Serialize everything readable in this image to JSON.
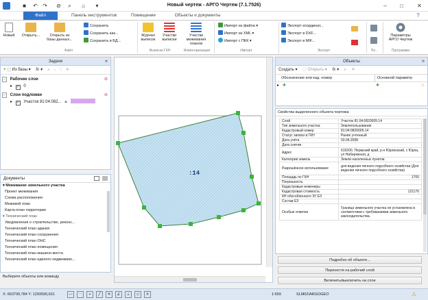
{
  "window": {
    "title": "Новый чертеж - АРГО Чертеж (7.1.7526)"
  },
  "tabs": [
    "Файл",
    "Панель инструментов",
    "Помещение",
    "Объекты и документы"
  ],
  "ribbon": {
    "big_buttons": [
      "Новый",
      "Открыть...",
      "Открыть из базы данных...",
      "Журнал выписок",
      "Участки выписки",
      "Участки межевания планов",
      "Параметры АРГО Чертеж"
    ],
    "save_buttons": [
      "Сохранить",
      "Сохранить как...",
      "Сохранить в БД..."
    ],
    "import_buttons": [
      "Импорт из файла",
      "Импорт из XML",
      "Импорт с ПКК"
    ],
    "export_buttons": [
      "Экспорт координат...",
      "Экспорт в DXF...",
      "Экспорт в MIF..."
    ],
    "groups": [
      "Файл",
      "Выписки ГКН",
      "Инвентаризация",
      "Импорт",
      "Экспорт",
      "Пе...",
      "Программа"
    ]
  },
  "tasks_panel": {
    "title": "Задачи",
    "toolbar_label": "Из базы",
    "working_section": "Рабочие слои",
    "working_layer": "0",
    "underlay_section": "Слои подложки",
    "underlay_layer": "Участок 81:04:082..."
  },
  "documents_panel": {
    "title": "Документы",
    "section_1": "Межевание земельного участка",
    "items_1": [
      "Проект межевания",
      "Схема расположения",
      "Межевой план",
      "Карта-план территории"
    ],
    "section_2": "Технический план",
    "items_2": [
      "Уведомления о строительстве, реконс...",
      "Технический план здания",
      "Технический план сооружения",
      "Технический план ОНС",
      "Технический план помещения",
      "Технический план машино-места",
      "Технический план единого недвижимо..."
    ]
  },
  "canvas": {
    "parcel_label": ":14"
  },
  "objects_panel": {
    "title": "Объекты",
    "create_label": "Создать",
    "open_label": "Открыть",
    "col_designation": "Обозначение или кад. номер",
    "col_main_param": "Основной параметр"
  },
  "properties": {
    "title": "Свойства выделенного объекта чертежа",
    "rows": [
      [
        "Слой",
        "Участок 81:04:0820005:14"
      ],
      [
        "Тип земельного участка",
        "Землепользование"
      ],
      [
        "Кадастровый номер",
        "81:04:0820005:14"
      ],
      [
        "Статус записи в ГКН",
        "Ранее учтенный"
      ],
      [
        "Дата учёта",
        "03.04.2008"
      ],
      [
        "Дата снятия",
        ""
      ],
      [
        "Адрес",
        "619200, Пермский край, р-н Юрлинский, с Юрла, ул Набережная, д"
      ],
      [
        "Категория земель",
        "Земли населенных пунктов"
      ],
      [
        "Разрешённое использование",
        "для ведения личного подсобного хозяйства (Для ведения личного подсобного хозяйства)"
      ],
      [
        "Площадь по ГКН",
        "1700"
      ],
      [
        "Погрешность",
        ""
      ],
      [
        "Кадастровые инженеры",
        ""
      ],
      [
        "Кадастровая стоимость",
        "121176"
      ],
      [
        "КН обособленного ЗУ ЕЗ",
        ""
      ],
      [
        "Состав ЕЗ",
        ""
      ],
      [
        "Особые отметки",
        "Граница земельного участка не установлена в соответствии с требованиями земельного законодательства."
      ]
    ]
  },
  "action_buttons": [
    "Подробно об объекте...",
    "Перенести на рабочий слой",
    "Включить/выключить на слое"
  ],
  "status": {
    "hint": "Выберите объекты или команду",
    "coords": "X: 663799,784 Y: 1293590,631",
    "scale": "1:659",
    "user": "SLM02\\ARGOGEO"
  },
  "colors": {
    "accent": "#2f73c9",
    "panel": "#dde7f3",
    "parcel_fill": "#b8d9ec",
    "vertex": "#3cb43c"
  }
}
